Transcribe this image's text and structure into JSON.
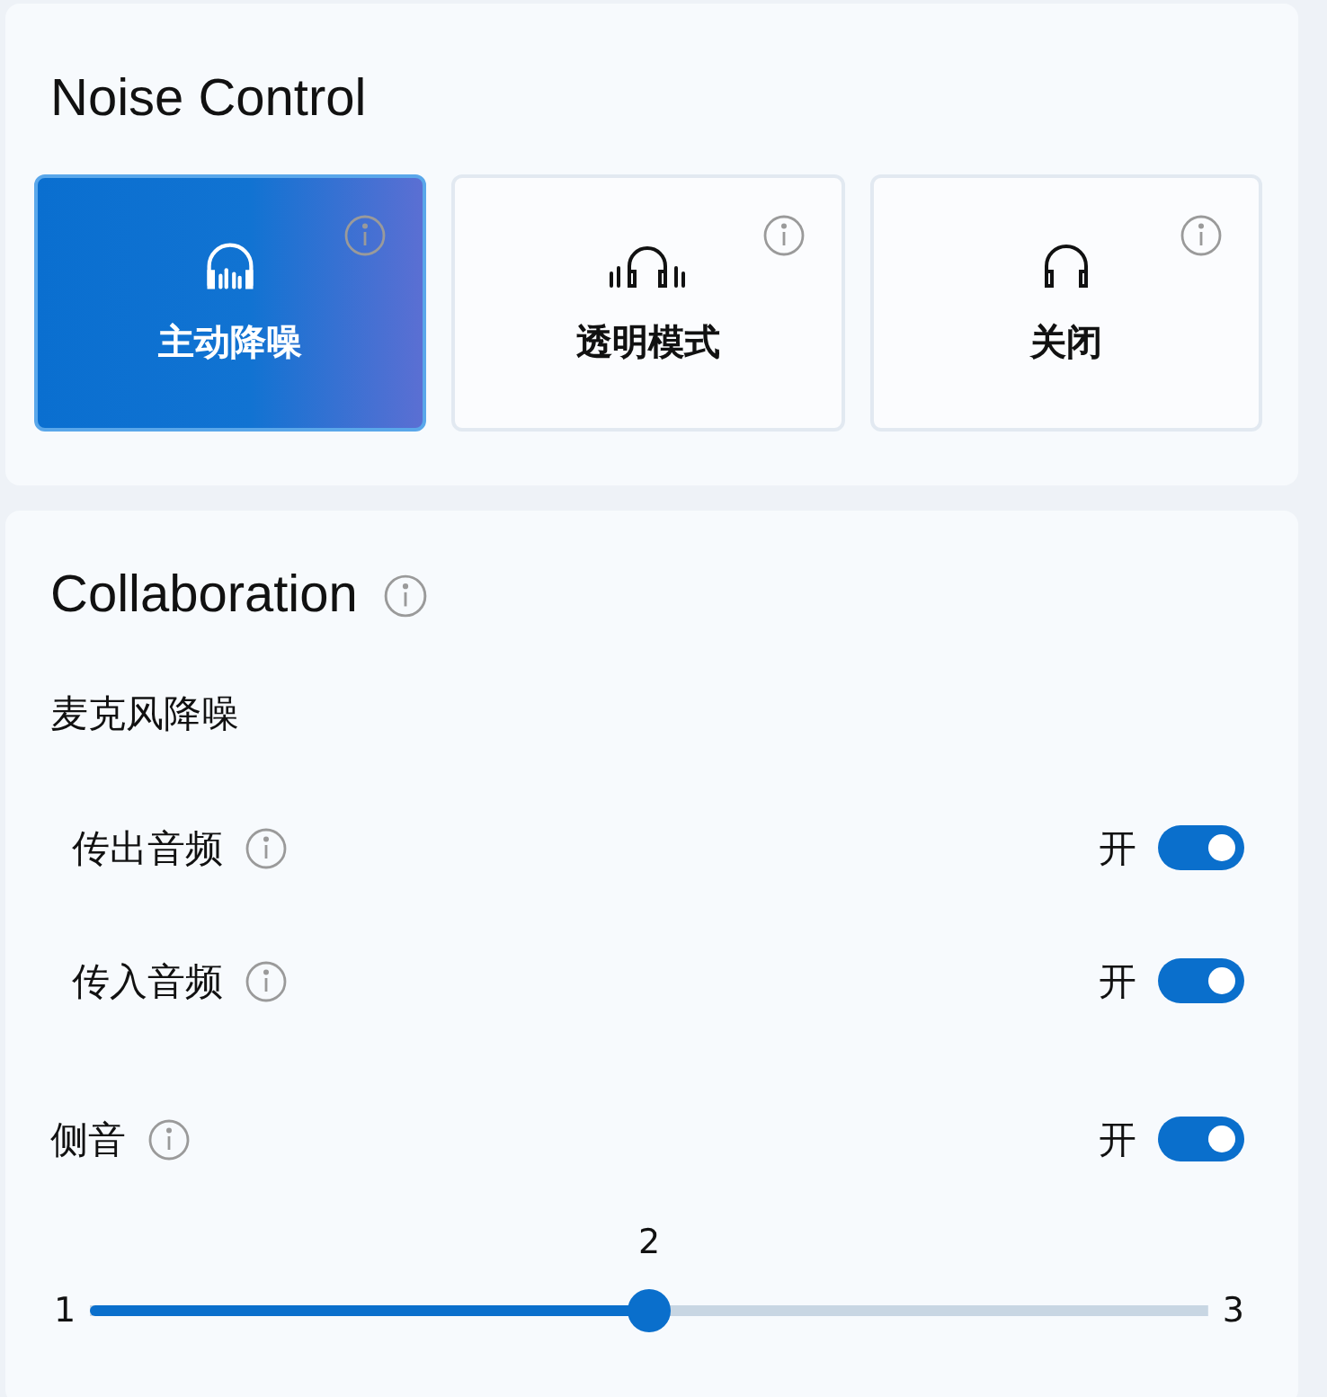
{
  "noise_control": {
    "title": "Noise Control",
    "modes": [
      {
        "label": "主动降噪",
        "kind": "anc",
        "selected": true
      },
      {
        "label": "透明模式",
        "kind": "transparency",
        "selected": false
      },
      {
        "label": "关闭",
        "kind": "off",
        "selected": false
      }
    ]
  },
  "collaboration": {
    "title": "Collaboration",
    "section_label": "麦克风降噪",
    "toggles": [
      {
        "label": "传出音频",
        "state_text": "开",
        "on": true,
        "indented": true
      },
      {
        "label": "传入音频",
        "state_text": "开",
        "on": true,
        "indented": true
      },
      {
        "label": "侧音",
        "state_text": "开",
        "on": true,
        "indented": false
      }
    ],
    "slider": {
      "min_label": "1",
      "value_label": "2",
      "max_label": "3",
      "level": 0.5
    }
  }
}
